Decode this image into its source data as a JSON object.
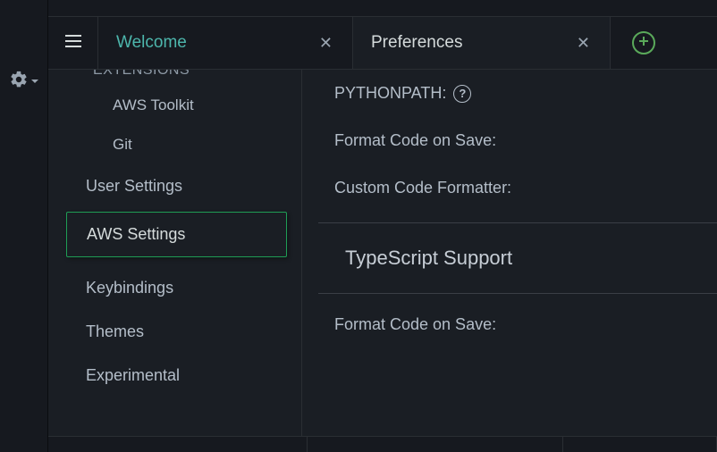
{
  "tabs": {
    "welcome": "Welcome",
    "preferences": "Preferences"
  },
  "sidebar": {
    "extensions_header": "EXTENSIONS",
    "ext_items": [
      {
        "label": "AWS Toolkit"
      },
      {
        "label": "Git"
      }
    ],
    "items": [
      {
        "label": "User Settings",
        "selected": false
      },
      {
        "label": "AWS Settings",
        "selected": true
      },
      {
        "label": "Keybindings",
        "selected": false
      },
      {
        "label": "Themes",
        "selected": false
      },
      {
        "label": "Experimental",
        "selected": false
      }
    ]
  },
  "panel": {
    "pythonpath_label": "PYTHONPATH:",
    "format_on_save_label": "Format Code on Save:",
    "custom_formatter_label": "Custom Code Formatter:",
    "section_typescript": "TypeScript Support",
    "format_on_save_label2": "Format Code on Save:"
  },
  "colors": {
    "accent_green": "#5aa95a",
    "border_green": "#1f9d55",
    "tab_teal": "#4db6ac"
  }
}
